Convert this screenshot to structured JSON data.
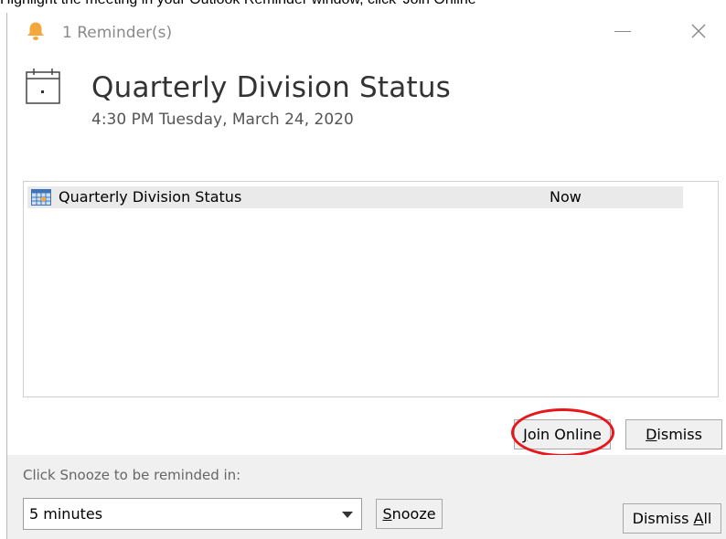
{
  "instruction": "Highlight the meeting in your Outlook Reminder window, click 'Join Online'",
  "window": {
    "title": "1 Reminder(s)",
    "icon": "bell-icon"
  },
  "reminder": {
    "subject": "Quarterly Division Status",
    "time": "4:30 PM Tuesday, March 24, 2020"
  },
  "list": {
    "items": [
      {
        "subject": "Quarterly Division Status",
        "due": "Now",
        "icon": "calendar-grid-icon"
      }
    ]
  },
  "buttons": {
    "join_online": {
      "pre": "",
      "key": "J",
      "post": "oin Online"
    },
    "dismiss": {
      "pre": "",
      "key": "D",
      "post": "ismiss"
    },
    "snooze": {
      "pre": "",
      "key": "S",
      "post": "nooze"
    },
    "dismiss_all": {
      "pre": "Dismiss ",
      "key": "A",
      "post": "ll"
    }
  },
  "snooze": {
    "label": "Click Snooze to be reminded in:",
    "selected": "5 minutes"
  },
  "colors": {
    "bell": "#f3a73d",
    "highlight_ring": "#e8161b",
    "footer_bg": "#f0f0f0"
  }
}
